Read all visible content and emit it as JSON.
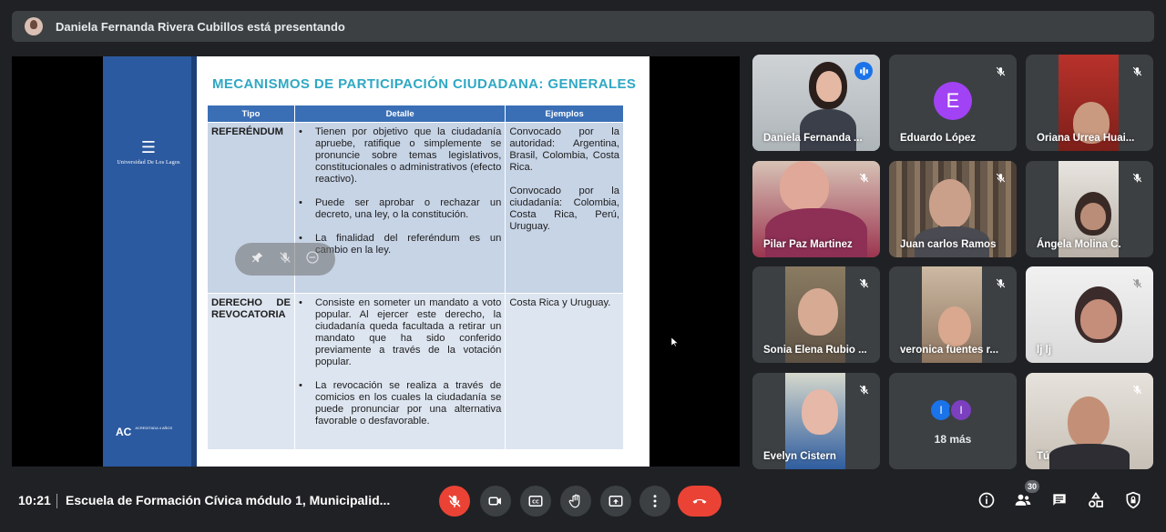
{
  "presenter": {
    "name_text": "Daniela Fernanda Rivera Cubillos está presentando"
  },
  "slide": {
    "university": "Universidad De Los Lagos",
    "acreditation_mark": "ACREDITADA 4 AÑOS",
    "title": "MECANISMOS DE PARTICIPACIÓN CIUDADANA: GENERALES",
    "headers": [
      "Tipo",
      "Detalle",
      "Ejemplos"
    ],
    "rows": [
      {
        "tipo": "REFERÉNDUM",
        "detalle": [
          "Tienen por objetivo que la ciudadanía apruebe, ratifique o simplemente se pronuncie sobre temas legislativos, constitucionales o administrativos (efecto reactivo).",
          "Puede ser aprobar o rechazar un decreto, una ley, o la constitución.",
          "La finalidad del referéndum es un cambio en la ley."
        ],
        "ejemplos": [
          "Convocado por la autoridad: Argentina, Brasil, Colombia, Costa Rica.",
          "Convocado por la ciudadanía: Colombia, Costa Rica, Perú, Uruguay."
        ]
      },
      {
        "tipo": "DERECHO DE REVOCATORIA",
        "detalle": [
          "Consiste en someter un mandato a voto popular. Al ejercer este derecho, la ciudadanía queda facultada a retirar un mandato que ha sido conferido previamente a través de la votación popular.",
          "La revocación se realiza a través de comicios en los cuales la ciudadanía se puede pronunciar por una alternativa favorable o desfavorable."
        ],
        "ejemplos": [
          "Costa Rica y Uruguay."
        ]
      }
    ]
  },
  "participants": [
    {
      "name": "Daniela Fernanda ...",
      "mic": "speaking"
    },
    {
      "name": "Eduardo López",
      "mic": "muted",
      "initial": "E"
    },
    {
      "name": "Oriana Urrea Huai...",
      "mic": "muted"
    },
    {
      "name": "Pilar Paz Martinez",
      "mic": "muted"
    },
    {
      "name": "Juan carlos Ramos",
      "mic": "muted"
    },
    {
      "name": "Ángela Molina C.",
      "mic": "muted"
    },
    {
      "name": "Sonia Elena Rubio ...",
      "mic": "muted"
    },
    {
      "name": "veronica fuentes r...",
      "mic": "muted"
    },
    {
      "name": "lj lj",
      "mic": "muted"
    },
    {
      "name": "Evelyn Cistern",
      "mic": "muted"
    },
    {
      "name": "18 más",
      "avatars": [
        "I",
        "I"
      ]
    },
    {
      "name": "Tú",
      "mic": "muted"
    }
  ],
  "bottom": {
    "time": "10:21",
    "meeting_title": "Escuela de Formación Cívica módulo 1, Municipalid...",
    "participants_count": "30"
  },
  "colors": {
    "accent_blue": "#1a73e8",
    "danger_red": "#ea4335",
    "avatar_purple": "#a142f4"
  }
}
